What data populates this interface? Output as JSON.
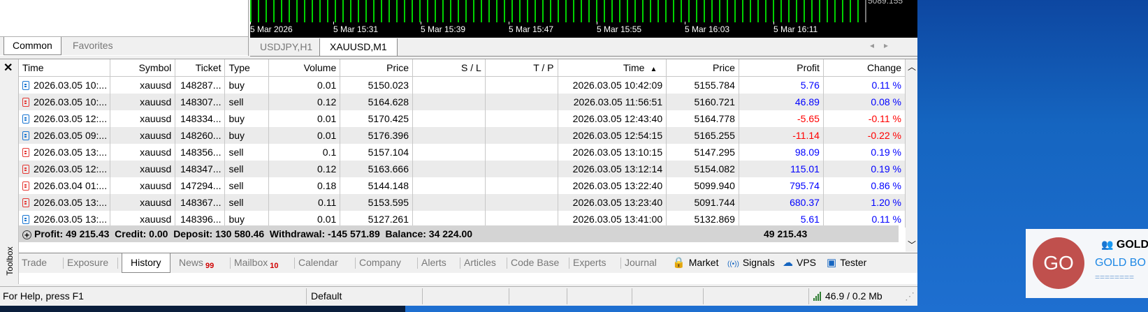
{
  "navigator": {
    "tabs": [
      "Common",
      "Favorites"
    ],
    "active_tab": "Common"
  },
  "chart": {
    "price_label": "5089.155",
    "time_labels": [
      "5 Mar 2026",
      "5 Mar 15:31",
      "5 Mar 15:39",
      "5 Mar 15:47",
      "5 Mar 15:55",
      "5 Mar 16:03",
      "5 Mar 16:11"
    ],
    "bar_color": "#00d000"
  },
  "chart_tabs": [
    "USDJPY,H1",
    "XAUUSD,M1"
  ],
  "chart_tab_active": "XAUUSD,M1",
  "toolbox": {
    "side_label": "Toolbox",
    "columns": [
      "Time",
      "Symbol",
      "Ticket",
      "Type",
      "Volume",
      "Price",
      "S / L",
      "T / P",
      "Time",
      "Price",
      "Profit",
      "Change"
    ],
    "sort_indicator": "▲",
    "rows": [
      {
        "open_time": "2026.03.05 10:...",
        "symbol": "xauusd",
        "ticket": "148287...",
        "type": "buy",
        "volume": "0.01",
        "open_price": "5150.023",
        "sl": "",
        "tp": "",
        "close_time": "2026.03.05 10:42:09",
        "close_price": "5155.784",
        "profit": "5.76",
        "change": "0.11 %"
      },
      {
        "open_time": "2026.03.05 10:...",
        "symbol": "xauusd",
        "ticket": "148307...",
        "type": "sell",
        "volume": "0.12",
        "open_price": "5164.628",
        "sl": "",
        "tp": "",
        "close_time": "2026.03.05 11:56:51",
        "close_price": "5160.721",
        "profit": "46.89",
        "change": "0.08 %"
      },
      {
        "open_time": "2026.03.05 12:...",
        "symbol": "xauusd",
        "ticket": "148334...",
        "type": "buy",
        "volume": "0.01",
        "open_price": "5170.425",
        "sl": "",
        "tp": "",
        "close_time": "2026.03.05 12:43:40",
        "close_price": "5164.778",
        "profit": "-5.65",
        "change": "-0.11 %"
      },
      {
        "open_time": "2026.03.05 09:...",
        "symbol": "xauusd",
        "ticket": "148260...",
        "type": "buy",
        "volume": "0.01",
        "open_price": "5176.396",
        "sl": "",
        "tp": "",
        "close_time": "2026.03.05 12:54:15",
        "close_price": "5165.255",
        "profit": "-11.14",
        "change": "-0.22 %"
      },
      {
        "open_time": "2026.03.05 13:...",
        "symbol": "xauusd",
        "ticket": "148356...",
        "type": "sell",
        "volume": "0.1",
        "open_price": "5157.104",
        "sl": "",
        "tp": "",
        "close_time": "2026.03.05 13:10:15",
        "close_price": "5147.295",
        "profit": "98.09",
        "change": "0.19 %"
      },
      {
        "open_time": "2026.03.05 12:...",
        "symbol": "xauusd",
        "ticket": "148347...",
        "type": "sell",
        "volume": "0.12",
        "open_price": "5163.666",
        "sl": "",
        "tp": "",
        "close_time": "2026.03.05 13:12:14",
        "close_price": "5154.082",
        "profit": "115.01",
        "change": "0.19 %"
      },
      {
        "open_time": "2026.03.04 01:...",
        "symbol": "xauusd",
        "ticket": "147294...",
        "type": "sell",
        "volume": "0.18",
        "open_price": "5144.148",
        "sl": "",
        "tp": "",
        "close_time": "2026.03.05 13:22:40",
        "close_price": "5099.940",
        "profit": "795.74",
        "change": "0.86 %"
      },
      {
        "open_time": "2026.03.05 13:...",
        "symbol": "xauusd",
        "ticket": "148367...",
        "type": "sell",
        "volume": "0.11",
        "open_price": "5153.595",
        "sl": "",
        "tp": "",
        "close_time": "2026.03.05 13:23:40",
        "close_price": "5091.744",
        "profit": "680.37",
        "change": "1.20 %"
      },
      {
        "open_time": "2026.03.05 13:...",
        "symbol": "xauusd",
        "ticket": "148396...",
        "type": "buy",
        "volume": "0.01",
        "open_price": "5127.261",
        "sl": "",
        "tp": "",
        "close_time": "2026.03.05 13:41:00",
        "close_price": "5132.869",
        "profit": "5.61",
        "change": "0.11 %"
      }
    ],
    "summary": {
      "text": "Profit: 49 215.43  Credit: 0.00  Deposit: 130 580.46  Withdrawal: -145 571.89  Balance: 34 224.00",
      "total": "49 215.43"
    },
    "tabs": [
      {
        "label": "Trade",
        "badge": ""
      },
      {
        "label": "Exposure",
        "badge": ""
      },
      {
        "label": "History",
        "badge": ""
      },
      {
        "label": "News",
        "badge": "99"
      },
      {
        "label": "Mailbox",
        "badge": "10"
      },
      {
        "label": "Calendar",
        "badge": ""
      },
      {
        "label": "Company",
        "badge": ""
      },
      {
        "label": "Alerts",
        "badge": ""
      },
      {
        "label": "Articles",
        "badge": ""
      },
      {
        "label": "Code Base",
        "badge": ""
      },
      {
        "label": "Experts",
        "badge": ""
      },
      {
        "label": "Journal",
        "badge": ""
      }
    ],
    "active_tab": "History",
    "right_tools": [
      {
        "label": "Market",
        "icon": "lock-bag-icon"
      },
      {
        "label": "Signals",
        "icon": "signal-icon"
      },
      {
        "label": "VPS",
        "icon": "cloud-icon"
      },
      {
        "label": "Tester",
        "icon": "chip-icon"
      }
    ]
  },
  "status_bar": {
    "help": "For Help, press F1",
    "profile": "Default",
    "connection": "46.9 / 0.2 Mb"
  },
  "notification": {
    "avatar": "GO",
    "title": "GOLD",
    "link": "GOLD BO",
    "line": "========"
  },
  "colors": {
    "profit_positive": "#0000ff",
    "profit_negative": "#ff0000",
    "buy_icon": "#1976d2",
    "sell_icon": "#e53935"
  }
}
